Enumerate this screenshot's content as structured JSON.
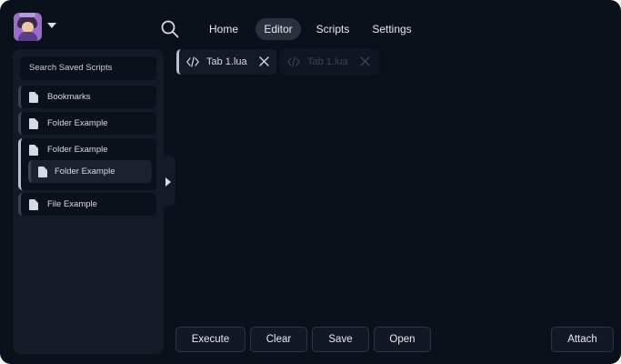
{
  "header": {
    "nav": [
      {
        "label": "Home",
        "active": false
      },
      {
        "label": "Editor",
        "active": true
      },
      {
        "label": "Scripts",
        "active": false
      },
      {
        "label": "Settings",
        "active": false
      }
    ]
  },
  "sidebar": {
    "search_placeholder": "Search Saved Scripts",
    "items": [
      {
        "label": "Bookmarks",
        "icon": "file-icon"
      },
      {
        "label": "Folder Example",
        "icon": "folder-icon"
      },
      {
        "label": "Folder Example",
        "icon": "folder-icon",
        "expanded": true,
        "children": [
          {
            "label": "Folder Example",
            "icon": "file-icon"
          }
        ]
      },
      {
        "label": "File Example",
        "icon": "file-icon"
      }
    ]
  },
  "tabs": [
    {
      "label": "Tab 1.lua",
      "active": true
    },
    {
      "label": "Tab 1.lua",
      "active": false
    }
  ],
  "actions": {
    "execute": "Execute",
    "clear": "Clear",
    "save": "Save",
    "open": "Open",
    "attach": "Attach"
  },
  "colors": {
    "background": "#0b111b",
    "panel": "#141b26",
    "text": "#e6e9ef",
    "accent": "#b9c0cc"
  }
}
